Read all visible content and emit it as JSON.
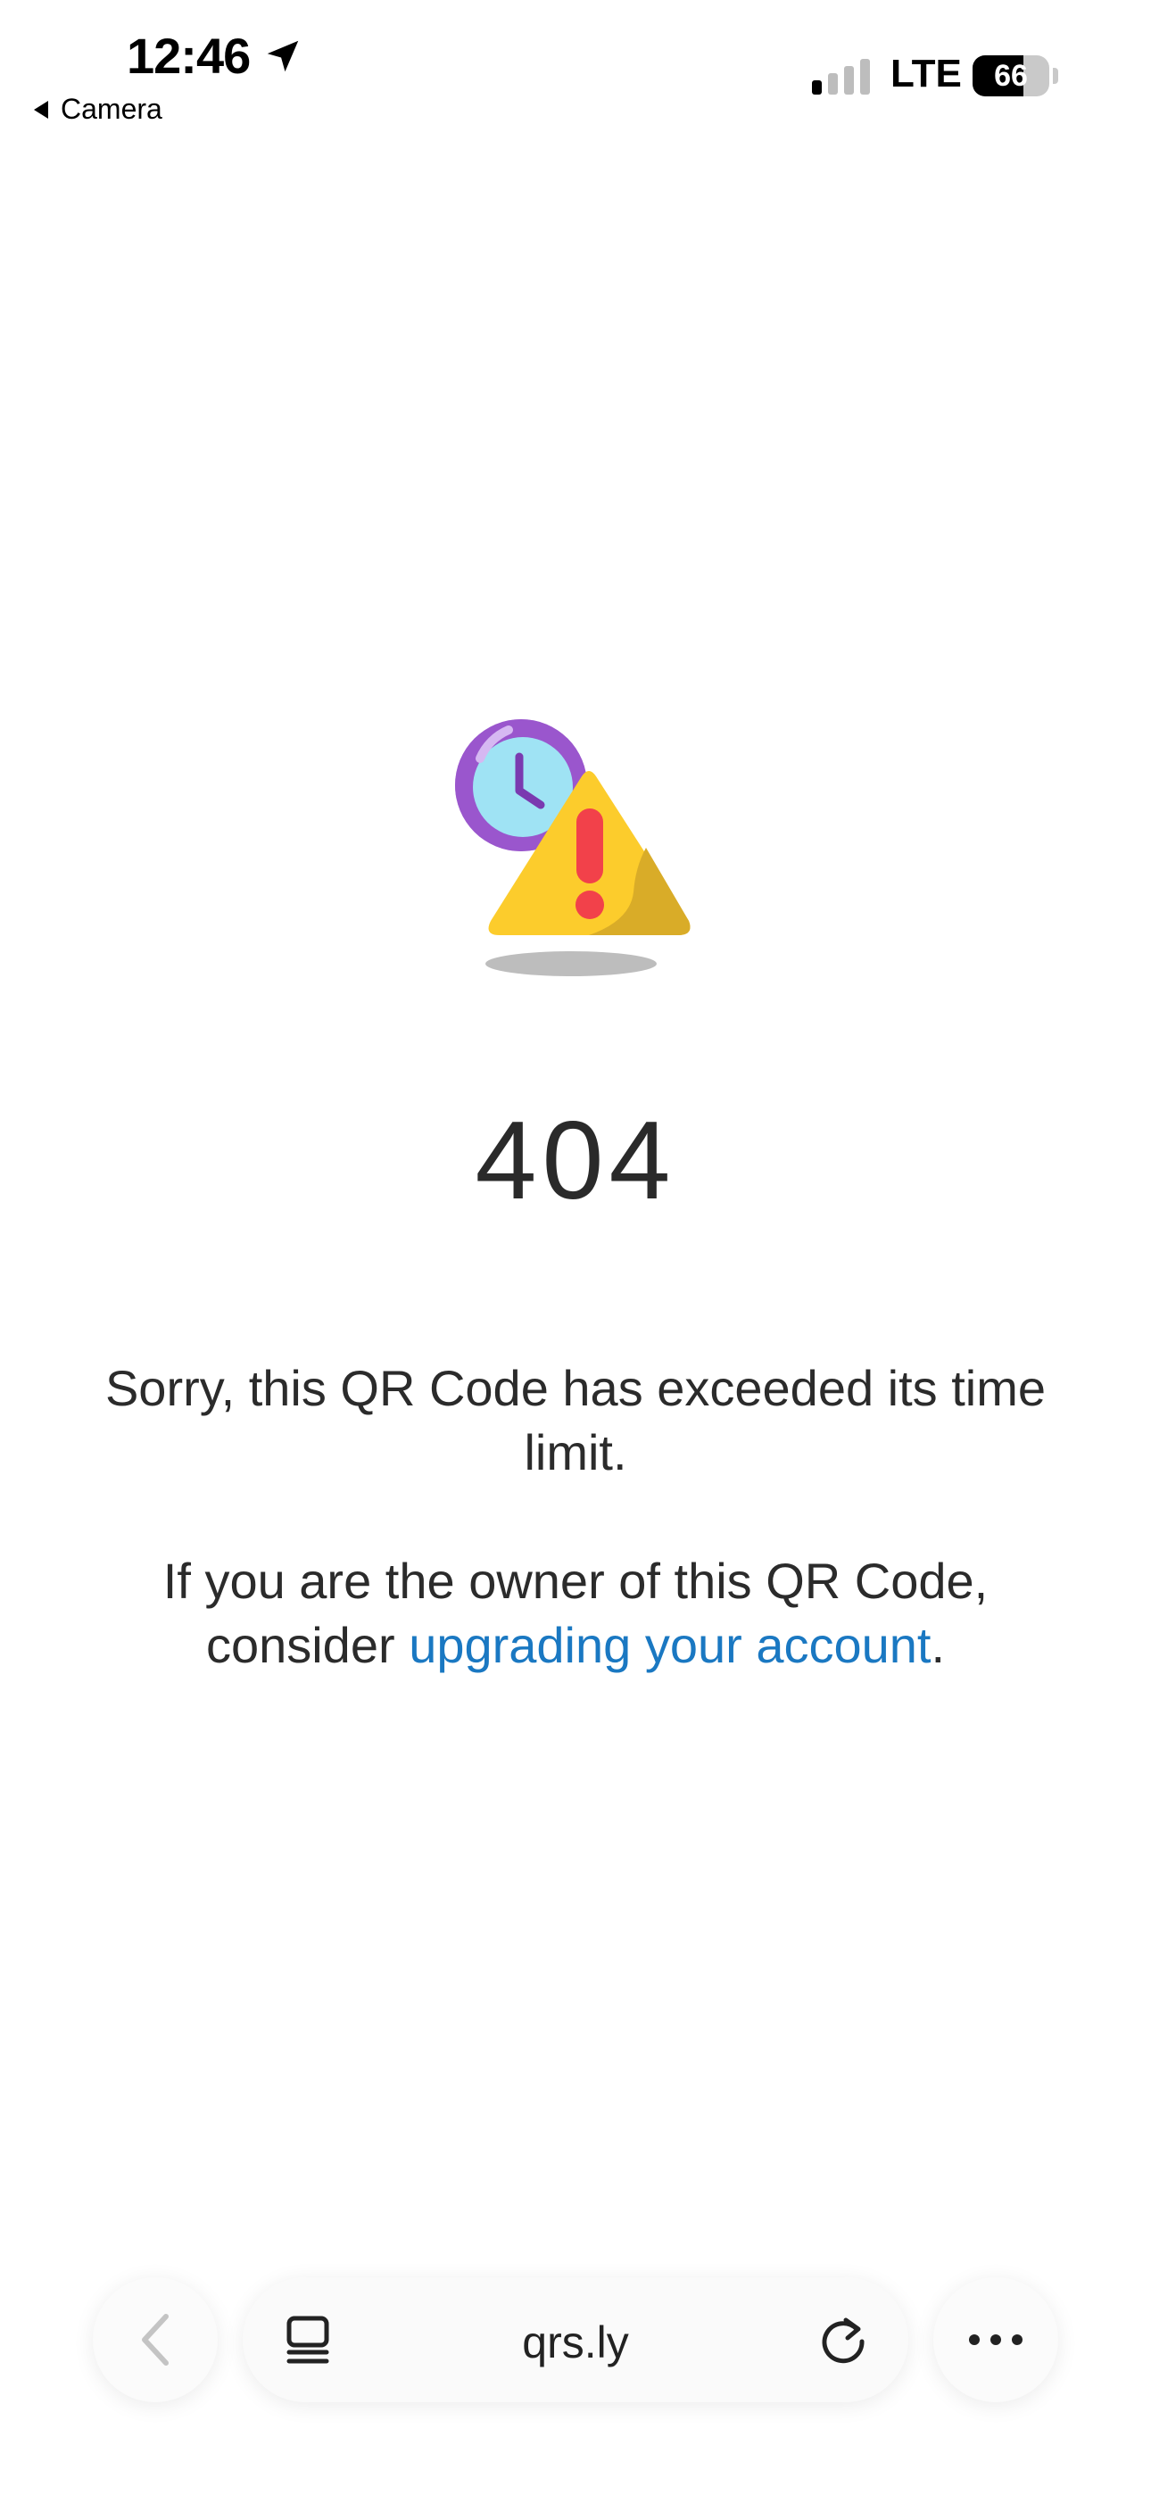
{
  "status_bar": {
    "time": "12:46",
    "back_app": "Camera",
    "network": "LTE",
    "battery_percent": "66",
    "battery_level": 0.66
  },
  "main": {
    "error_code": "404",
    "message_line1": "Sorry, this QR Code has exceeded its time limit.",
    "message2_prefix": "If you are the owner of this QR Code, consider ",
    "message2_link": "upgrading your account",
    "message2_suffix": ".",
    "link_color": "#1a78c2"
  },
  "toolbar": {
    "url": "qrs.ly"
  },
  "icons": {
    "location": "location-arrow-icon",
    "signal": "signal-bars-icon",
    "battery": "battery-icon",
    "illustration": "clock-warning-icon",
    "back": "chevron-left-icon",
    "tabs": "tabs-icon",
    "reload": "reload-icon",
    "more": "more-dots-icon"
  }
}
